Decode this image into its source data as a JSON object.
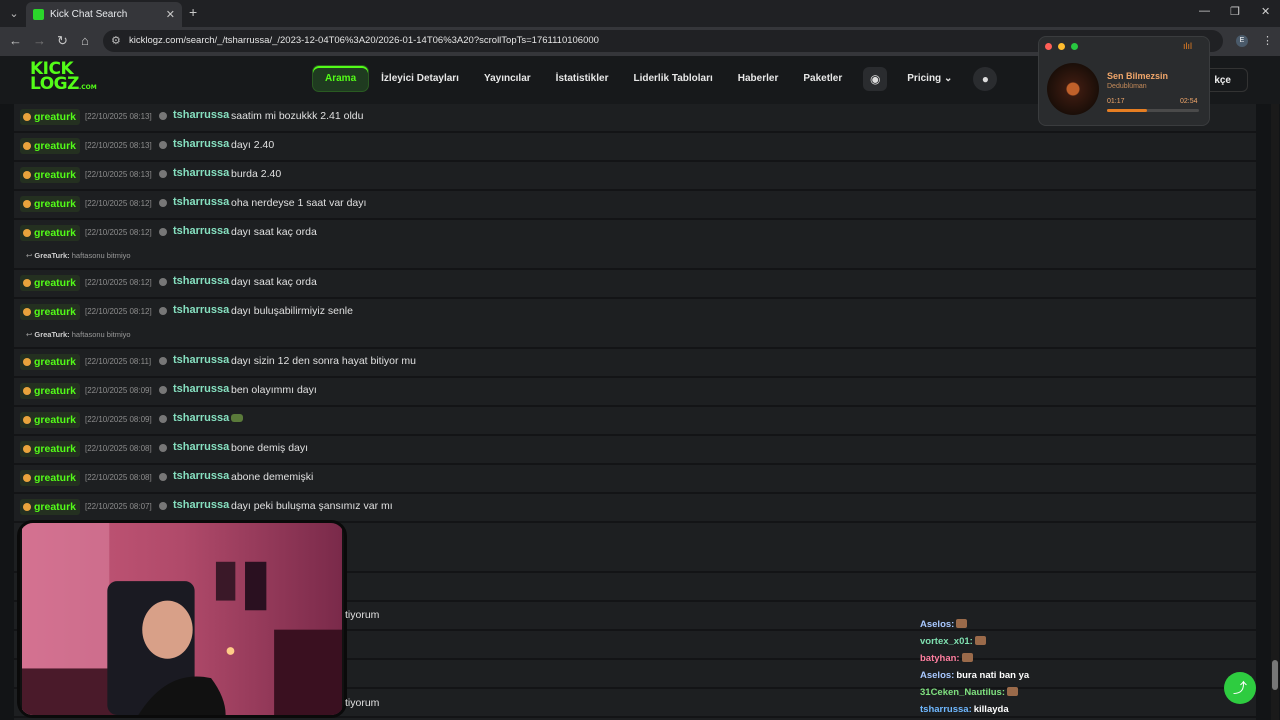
{
  "browser": {
    "tab_title": "Kick Chat Search",
    "url": "kicklogz.com/search/_/tsharrussa/_/2023-12-04T06%3A20/2026-01-14T06%3A20?scrollTopTs=1761110106000",
    "profile_initial": "E"
  },
  "site": {
    "logo_line1": "KICK",
    "logo_line2": "LOGZ",
    "logo_domain": ".COM",
    "nav": [
      "Arama",
      "İzleyici Detayları",
      "Yayıncılar",
      "İstatistikler",
      "Liderlik Tabloları",
      "Haberler",
      "Paketler"
    ],
    "pricing": "Pricing",
    "lang": "kçe"
  },
  "messages": [
    {
      "badge": "greaturk",
      "time": "[22/10/2025 08:13]",
      "user": "tsharrussa",
      "text": "saatim mi bozukkk 2.41 oldu"
    },
    {
      "badge": "greaturk",
      "time": "[22/10/2025 08:13]",
      "user": "tsharrussa",
      "text": "dayı 2.40"
    },
    {
      "badge": "greaturk",
      "time": "[22/10/2025 08:13]",
      "user": "tsharrussa",
      "text": "burda 2.40"
    },
    {
      "badge": "greaturk",
      "time": "[22/10/2025 08:12]",
      "user": "tsharrussa",
      "text": "oha nerdeyse 1 saat var dayı"
    },
    {
      "badge": "greaturk",
      "time": "[22/10/2025 08:12]",
      "user": "tsharrussa",
      "text": "dayı saat kaç orda",
      "reply_user": "GreaTurk:",
      "reply_text": "haftasonu bitmiyo"
    },
    {
      "badge": "greaturk",
      "time": "[22/10/2025 08:12]",
      "user": "tsharrussa",
      "text": "dayı saat kaç orda"
    },
    {
      "badge": "greaturk",
      "time": "[22/10/2025 08:12]",
      "user": "tsharrussa",
      "text": "dayı buluşabilirmiyiz senle",
      "reply_user": "GreaTurk:",
      "reply_text": "haftasonu bitmiyo"
    },
    {
      "badge": "greaturk",
      "time": "[22/10/2025 08:11]",
      "user": "tsharrussa",
      "text": "dayı sizin 12 den sonra hayat bitiyor mu"
    },
    {
      "badge": "greaturk",
      "time": "[22/10/2025 08:09]",
      "user": "tsharrussa",
      "text": "ben olayımmı dayı"
    },
    {
      "badge": "greaturk",
      "time": "[22/10/2025 08:09]",
      "user": "tsharrussa",
      "text": ""
    },
    {
      "badge": "greaturk",
      "time": "[22/10/2025 08:08]",
      "user": "tsharrussa",
      "text": "bone demiş dayı"
    },
    {
      "badge": "greaturk",
      "time": "[22/10/2025 08:08]",
      "user": "tsharrussa",
      "text": "abone dememişki"
    },
    {
      "badge": "greaturk",
      "time": "[22/10/2025 08:07]",
      "user": "tsharrussa",
      "text": "dayı peki buluşma şansımız var mı"
    }
  ],
  "partial_texts": [
    "tiyorum",
    "tiyorum"
  ],
  "music": {
    "song": "Sen Bilmezsin",
    "artist": "Dedublüman",
    "current": "01:17",
    "total": "02:54",
    "progress": 0.44
  },
  "stream_chat": [
    {
      "name": "Aselos:",
      "color": "#a8c8ff",
      "text": ""
    },
    {
      "name": "vortex_x01:",
      "color": "#7fe0b0",
      "text": ""
    },
    {
      "name": "batyhan:",
      "color": "#ff7fa0",
      "text": ""
    },
    {
      "name": "Aselos:",
      "color": "#a8c8ff",
      "text": "bura nati ban ya"
    },
    {
      "name": "31Ceken_Nautilus:",
      "color": "#7fe07f",
      "text": ""
    },
    {
      "name": "tsharrussa:",
      "color": "#6fb8ff",
      "text": "killayda"
    }
  ],
  "colors": {
    "accent": "#53fc18",
    "username": "#86e0c0",
    "share": "#2ecc40"
  }
}
